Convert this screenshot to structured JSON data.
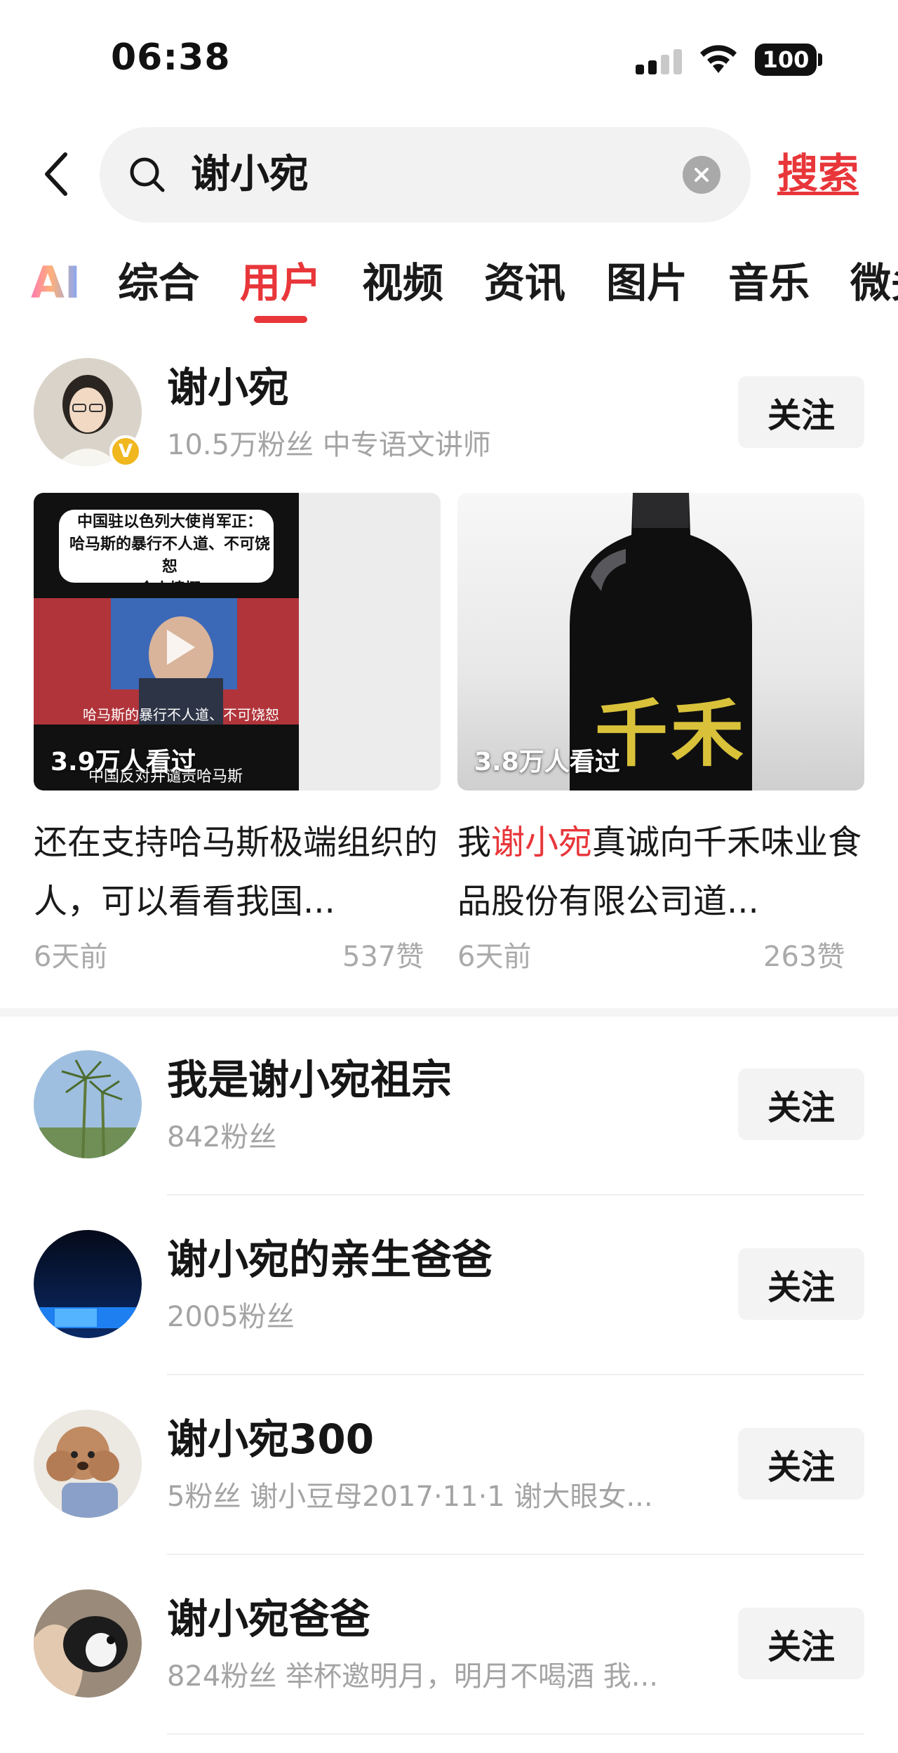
{
  "status_bar": {
    "time": "06:38",
    "battery": "100",
    "icons": [
      "cellular-signal-icon",
      "wifi-icon",
      "battery-icon"
    ]
  },
  "search": {
    "query": "谢小宛",
    "action_label": "搜索",
    "icons": [
      "back-arrow-icon",
      "search-icon",
      "clear-icon"
    ]
  },
  "tabs": {
    "ai_label": "AI",
    "items": [
      "综合",
      "用户",
      "视频",
      "资讯",
      "图片",
      "音乐",
      "微头条"
    ],
    "active": "用户"
  },
  "top_user": {
    "name": "谢小宛",
    "meta": "10.5万粉丝  中专语文讲师",
    "follow_label": "关注",
    "verified_badge": "V",
    "videos": [
      {
        "thumb_lines": [
          "中国驻以色列大使肖军正：",
          "哈马斯的暴行不人道、不可饶恕",
          "令人愤慨"
        ],
        "subtitle": "哈马斯的暴行不人道、不可饶恕",
        "caption": "中国反对并谴责哈马斯",
        "views": "3.9万人看过",
        "title": "还在支持哈马斯极端组织的人，可以看看我国...",
        "time": "6天前",
        "likes": "537赞"
      },
      {
        "thumb_text": "千禾",
        "views": "3.8万人看过",
        "title_prefix": "我",
        "title_highlight": "谢小宛",
        "title_suffix": "真诚向千禾味业食品股份有限公司道...",
        "time": "6天前",
        "likes": "263赞"
      }
    ]
  },
  "users": [
    {
      "name": "我是谢小宛祖宗",
      "meta": "842粉丝",
      "follow_label": "关注"
    },
    {
      "name": "谢小宛的亲生爸爸",
      "meta": "2005粉丝",
      "follow_label": "关注"
    },
    {
      "name": "谢小宛300",
      "meta": "5粉丝  谢小豆母2017·11·1 谢大眼女...",
      "follow_label": "关注"
    },
    {
      "name": "谢小宛爸爸",
      "meta": "824粉丝  举杯邀明月，明月不喝酒 我...",
      "follow_label": "关注"
    }
  ],
  "colors": {
    "accent": "#e8363a",
    "muted_text": "#a4a4a4",
    "button_bg": "#f3f3f3",
    "search_bg": "#f2f2f2"
  }
}
